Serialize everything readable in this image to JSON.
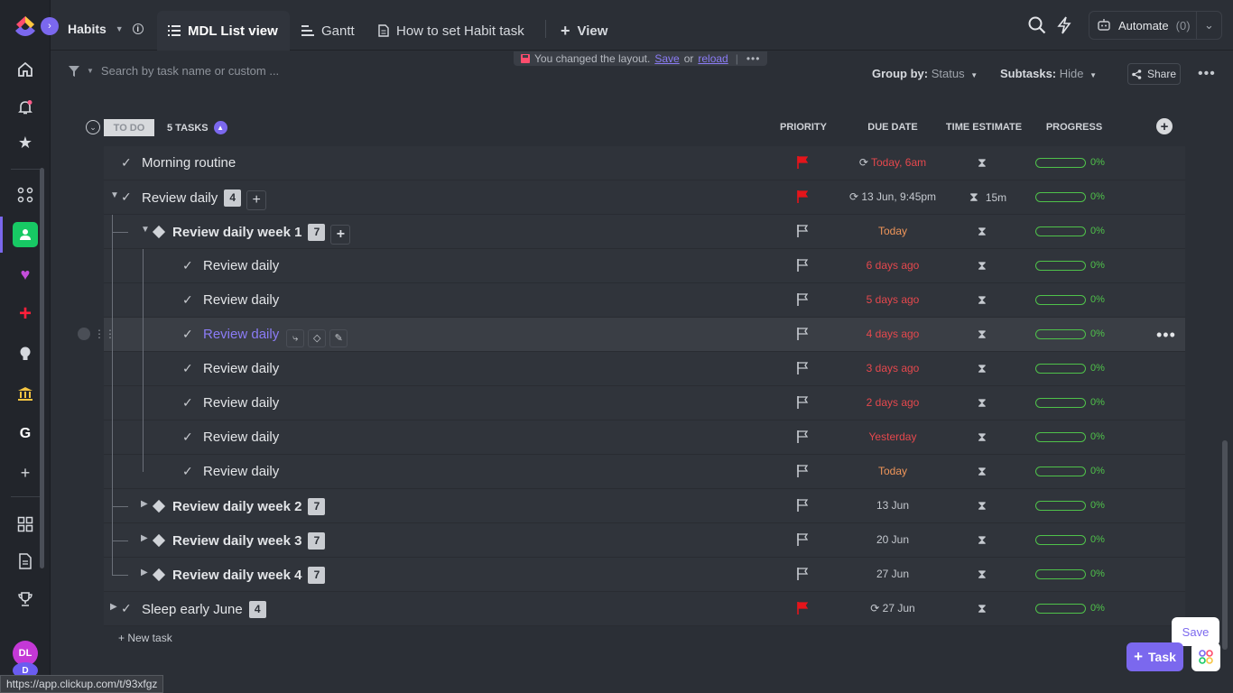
{
  "space": {
    "name": "Habits"
  },
  "tabs": [
    {
      "label": "MDL List view",
      "icon": "list-icon"
    },
    {
      "label": "Gantt",
      "icon": "gantt-icon"
    },
    {
      "label": "How to set Habit task",
      "icon": "doc-icon"
    }
  ],
  "add_view_label": "View",
  "automate": {
    "label": "Automate",
    "count": "(0)"
  },
  "search": {
    "placeholder": "Search by task name or custom ..."
  },
  "layout_notice": {
    "text": "You changed the layout.",
    "save": "Save",
    "or": "or",
    "reload": "reload"
  },
  "group_by": {
    "label": "Group by:",
    "value": "Status"
  },
  "subtasks": {
    "label": "Subtasks:",
    "value": "Hide"
  },
  "share_label": "Share",
  "group": {
    "status": "TO DO",
    "count": "5 TASKS"
  },
  "columns": {
    "priority": "PRIORITY",
    "due": "DUE DATE",
    "time": "TIME ESTIMATE",
    "progress": "PROGRESS"
  },
  "rows": [
    {
      "name": "Morning routine",
      "badge": "",
      "due": "Today, 6am",
      "time": "",
      "progress": "0%",
      "progress_value": 0
    },
    {
      "name": "Review daily",
      "badge": "4",
      "due": "13 Jun, 9:45pm",
      "time": "15m",
      "progress": "0%",
      "progress_value": 0
    },
    {
      "name": "Review daily week 1",
      "badge": "7",
      "due": "Today",
      "time": "",
      "progress": "0%",
      "progress_value": 0
    },
    {
      "name": "Review daily",
      "badge": "",
      "due": "6 days ago",
      "time": "",
      "progress": "0%",
      "progress_value": 0
    },
    {
      "name": "Review daily",
      "badge": "",
      "due": "5 days ago",
      "time": "",
      "progress": "0%",
      "progress_value": 0
    },
    {
      "name": "Review daily",
      "badge": "",
      "due": "4 days ago",
      "time": "",
      "progress": "0%",
      "progress_value": 0
    },
    {
      "name": "Review daily",
      "badge": "",
      "due": "3 days ago",
      "time": "",
      "progress": "0%",
      "progress_value": 0
    },
    {
      "name": "Review daily",
      "badge": "",
      "due": "2 days ago",
      "time": "",
      "progress": "0%",
      "progress_value": 0
    },
    {
      "name": "Review daily",
      "badge": "",
      "due": "Yesterday",
      "time": "",
      "progress": "0%",
      "progress_value": 0
    },
    {
      "name": "Review daily",
      "badge": "",
      "due": "Today",
      "time": "",
      "progress": "0%",
      "progress_value": 0
    },
    {
      "name": "Review daily week 2",
      "badge": "7",
      "due": "13 Jun",
      "time": "",
      "progress": "0%",
      "progress_value": 0
    },
    {
      "name": "Review daily week 3",
      "badge": "7",
      "due": "20 Jun",
      "time": "",
      "progress": "0%",
      "progress_value": 0
    },
    {
      "name": "Review daily week 4",
      "badge": "7",
      "due": "27 Jun",
      "time": "",
      "progress": "0%",
      "progress_value": 0
    },
    {
      "name": "Sleep early June",
      "badge": "4",
      "due": "27 Jun",
      "time": "",
      "progress": "0%",
      "progress_value": 0
    }
  ],
  "new_task_label": "+ New task",
  "save_popup": "Save",
  "task_button": "Task",
  "rail": {
    "g_label": "G",
    "avatar_dl": "DL",
    "avatar_d": "D"
  },
  "url_tooltip": "https://app.clickup.com/t/93xfgz",
  "colors": {
    "accent": "#7b68ee",
    "progress": "#4fc24a",
    "overdue": "#e5484d",
    "today": "#f0965a",
    "priority_urgent": "#e5151b"
  }
}
